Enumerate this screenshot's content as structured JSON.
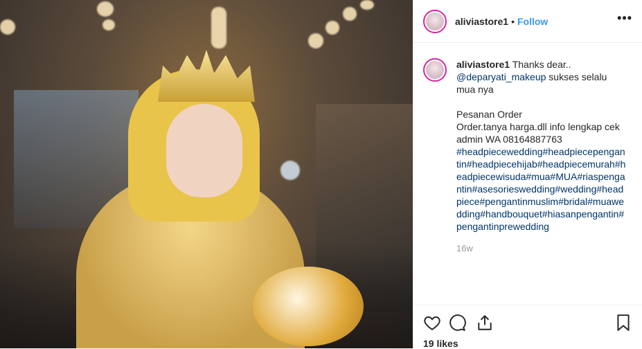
{
  "post": {
    "username": "aliviastore1",
    "follow_label": "Follow",
    "separator": "•",
    "more_label": "•••"
  },
  "caption": {
    "username": "aliviastore1",
    "line1": "Thanks dear..",
    "mention": "@deparyati_makeup",
    "line2": " sukses selalu mua nya",
    "order_title": "Pesanan Order",
    "order_text": "Order.tanya harga.dll info lengkap cek admin WA 08164887763",
    "hashtags": "#headpiecewedding#headpiecepengantin#headpiecehijab#headpiecemurah#headpiecewisuda#mua#MUA#riaspengantin#asesorieswedding#wedding#headpiece#pengantinmuslim#bridal#muawedding#handbouquet#hiasanpengantin#pengantinprewedding",
    "time": "16w"
  },
  "actions": {
    "like_icon": "heart-icon",
    "comment_icon": "comment-icon",
    "share_icon": "share-icon",
    "save_icon": "bookmark-icon",
    "likes": "19 likes"
  }
}
